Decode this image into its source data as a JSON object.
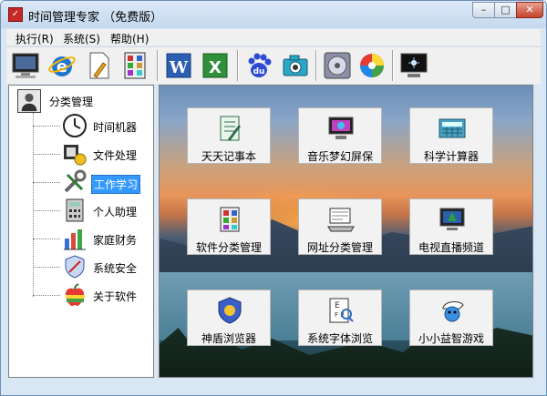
{
  "window": {
    "title": "时间管理专家 （免费版）",
    "controls": {
      "minimize": "–",
      "maximize": "□",
      "close": "✕"
    }
  },
  "menu": [
    {
      "label": "执行(R)"
    },
    {
      "label": "系统(S)"
    },
    {
      "label": "帮助(H)"
    }
  ],
  "toolbar": [
    {
      "name": "computer-icon"
    },
    {
      "name": "internet-explorer-icon"
    },
    {
      "name": "notepad-icon"
    },
    {
      "name": "calculator-apps-icon"
    },
    {
      "name": "word-icon"
    },
    {
      "name": "excel-icon"
    },
    {
      "name": "baidu-icon"
    },
    {
      "name": "camera-icon"
    },
    {
      "name": "media-player-icon"
    },
    {
      "name": "color-disc-icon"
    },
    {
      "name": "screen-icon"
    }
  ],
  "tree": {
    "root": "分类管理",
    "items": [
      {
        "label": "时间机器",
        "icon": "clock-icon"
      },
      {
        "label": "文件处理",
        "icon": "file-process-icon"
      },
      {
        "label": "工作学习",
        "icon": "tools-icon",
        "selected": true
      },
      {
        "label": "个人助理",
        "icon": "calculator-icon"
      },
      {
        "label": "家庭财务",
        "icon": "finance-chart-icon"
      },
      {
        "label": "系统安全",
        "icon": "security-icon"
      },
      {
        "label": "关于软件",
        "icon": "apple-icon"
      }
    ]
  },
  "tiles": [
    {
      "label": "天天记事本",
      "icon": "notebook-icon"
    },
    {
      "label": "音乐梦幻屏保",
      "icon": "music-screensaver-icon"
    },
    {
      "label": "科学计算器",
      "icon": "scientific-calculator-icon"
    },
    {
      "label": "软件分类管理",
      "icon": "software-manager-icon"
    },
    {
      "label": "网址分类管理",
      "icon": "url-manager-icon"
    },
    {
      "label": "电视直播频道",
      "icon": "tv-live-icon"
    },
    {
      "label": "神盾浏览器",
      "icon": "shield-browser-icon"
    },
    {
      "label": "系统字体浏览",
      "icon": "font-viewer-icon"
    },
    {
      "label": "小小益智游戏",
      "icon": "smurf-game-icon"
    }
  ]
}
